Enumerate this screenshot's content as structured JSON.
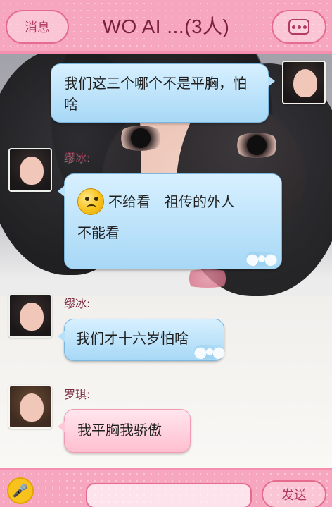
{
  "header": {
    "back_label": "消息",
    "title": "WO AI ...(3人)",
    "more_icon": "more-icon"
  },
  "messages": [
    {
      "side": "right",
      "sender": "",
      "text": "我们这三个哪个不是平胸，怕啥"
    },
    {
      "side": "left",
      "sender": "缪冰:",
      "text_line1": "不给看　祖传的外人",
      "text_line2": "不能看"
    },
    {
      "side": "left",
      "sender": "缪冰:",
      "text": "我们才十六岁怕啥"
    },
    {
      "side": "left",
      "sender": "罗琪:",
      "text": "我平胸我骄傲"
    }
  ],
  "bottom": {
    "input_value": "",
    "send_label": "发送"
  }
}
